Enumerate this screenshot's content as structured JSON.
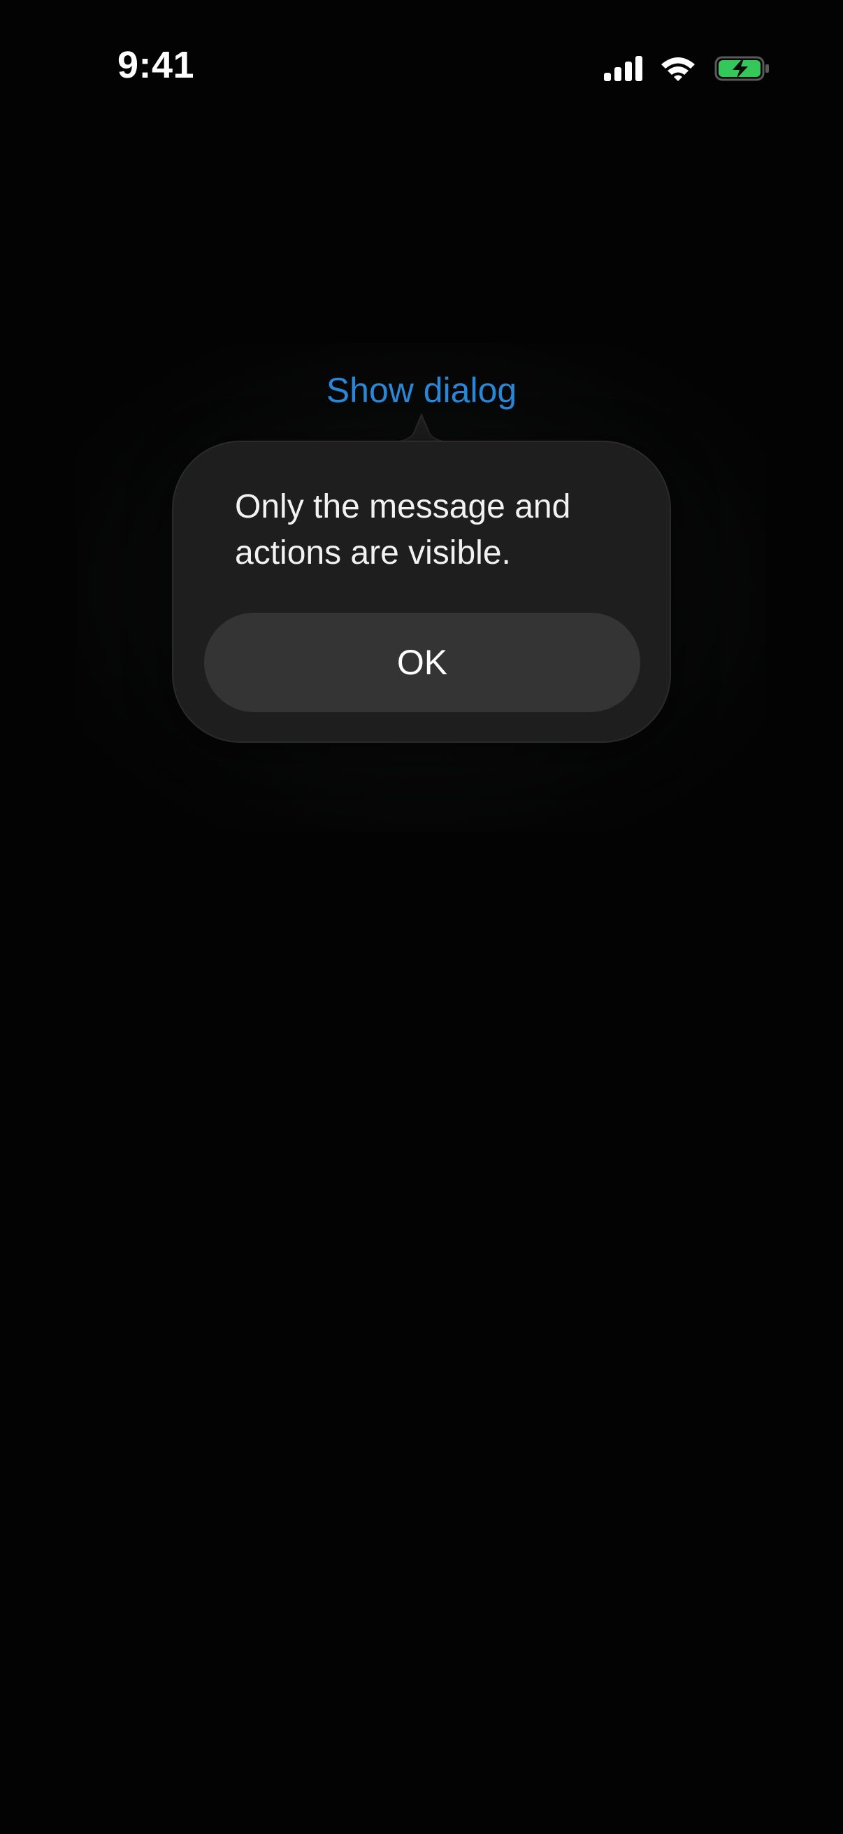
{
  "status_bar": {
    "time": "9:41",
    "icons": [
      "signal-icon",
      "wifi-icon",
      "battery-charging-icon"
    ],
    "battery_color": "#34c759"
  },
  "main": {
    "show_dialog_label": "Show dialog",
    "link_color": "#2a86d6"
  },
  "popover": {
    "message": "Only the message and actions are visible.",
    "ok_label": "OK"
  }
}
